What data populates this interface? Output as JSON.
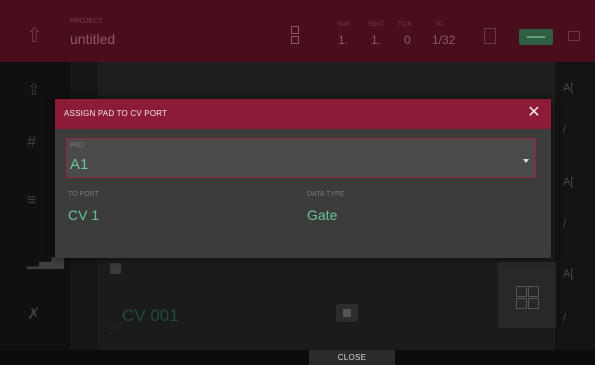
{
  "header": {
    "project_label": "PROJECT",
    "project_name": "untitled",
    "bar_label": "BAR",
    "bar_value": "1.",
    "beat_label": "BEAT",
    "beat_value": "1.",
    "tick_label": "TICK",
    "tick_value": "0",
    "tc_label": "TC",
    "tc_value": "1/32"
  },
  "background": {
    "cv_name": "CV 001",
    "cv_hint": "CV"
  },
  "modal": {
    "title": "ASSIGN PAD TO CV PORT",
    "close_glyph": "✕",
    "pad_label": "PAD",
    "pad_value": "A1",
    "to_port_label": "TO PORT",
    "to_port_value": "CV 1",
    "data_type_label": "DATA TYPE",
    "data_type_value": "Gate"
  },
  "bottom_bar": {
    "close_label": "CLOSE"
  },
  "right_column": [
    "A[",
    "/",
    "A[",
    "/",
    "A[",
    "/"
  ],
  "colors": {
    "accent": "#8c1b37",
    "value_green": "#66c799"
  }
}
